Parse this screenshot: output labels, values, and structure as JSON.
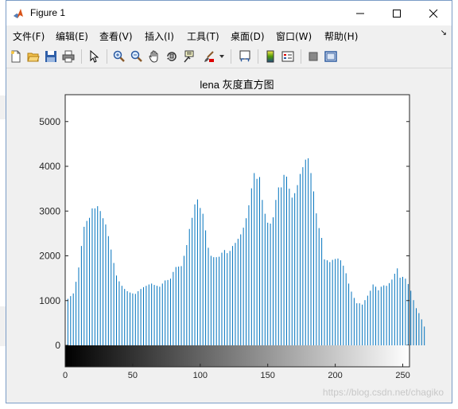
{
  "window": {
    "title": "Figure 1",
    "minimize_icon": "minimize-icon",
    "maximize_icon": "maximize-icon",
    "close_icon": "close-icon"
  },
  "menu": {
    "items": [
      {
        "label": "文件(F)"
      },
      {
        "label": "编辑(E)"
      },
      {
        "label": "查看(V)"
      },
      {
        "label": "插入(I)"
      },
      {
        "label": "工具(T)"
      },
      {
        "label": "桌面(D)"
      },
      {
        "label": "窗口(W)"
      },
      {
        "label": "帮助(H)"
      }
    ],
    "overflow_icon": "chevron-right-icon"
  },
  "toolbar": {
    "icons": [
      "new-figure-icon",
      "open-file-icon",
      "save-icon",
      "print-icon",
      "select-arrow-icon",
      "zoom-in-icon",
      "zoom-out-icon",
      "pan-icon",
      "rotate-3d-icon",
      "data-cursor-icon",
      "brush-icon",
      "link-plot-icon",
      "insert-colorbar-icon",
      "insert-legend-icon",
      "hide-plot-tools-icon",
      "show-plot-tools-icon"
    ]
  },
  "watermark": "https://blog.csdn.net/chagiko",
  "chart_data": {
    "type": "bar",
    "title": "lena 灰度直方图",
    "xlabel": "",
    "ylabel": "",
    "xlim": [
      0,
      255
    ],
    "ylim": [
      0,
      5600
    ],
    "x_ticks": [
      "0",
      "50",
      "100",
      "150",
      "200",
      "250"
    ],
    "y_ticks": [
      "0",
      "1000",
      "2000",
      "3000",
      "4000",
      "5000"
    ],
    "colormap": "gray",
    "bar_color": "#0072bd",
    "bins_start": 0,
    "bin_width": 2,
    "values": [
      430,
      1040,
      1100,
      1160,
      1420,
      1740,
      2220,
      2650,
      2780,
      2850,
      3060,
      3060,
      3110,
      3000,
      2840,
      2700,
      2440,
      2140,
      1840,
      1560,
      1430,
      1330,
      1260,
      1210,
      1180,
      1160,
      1150,
      1210,
      1260,
      1300,
      1330,
      1360,
      1380,
      1350,
      1330,
      1310,
      1380,
      1450,
      1460,
      1490,
      1640,
      1750,
      1760,
      1770,
      2000,
      2240,
      2600,
      2850,
      3150,
      3260,
      3070,
      2940,
      2570,
      2180,
      2000,
      1970,
      1970,
      1980,
      2070,
      2130,
      2060,
      2110,
      2220,
      2290,
      2380,
      2480,
      2630,
      2840,
      3130,
      3510,
      3850,
      3720,
      3760,
      3250,
      2940,
      2740,
      2720,
      2860,
      3250,
      3530,
      3530,
      3810,
      3770,
      3500,
      3300,
      3400,
      3580,
      3830,
      3980,
      4150,
      4180,
      3850,
      3440,
      2950,
      2620,
      2400,
      1920,
      1900,
      1860,
      1910,
      1930,
      1940,
      1900,
      1780,
      1610,
      1380,
      1200,
      1060,
      940,
      940,
      910,
      1010,
      1110,
      1220,
      1360,
      1310,
      1230,
      1310,
      1340,
      1330,
      1390,
      1470,
      1600,
      1720,
      1510,
      1530,
      1490,
      1370,
      1220,
      1010,
      830,
      720,
      580,
      420
    ]
  }
}
